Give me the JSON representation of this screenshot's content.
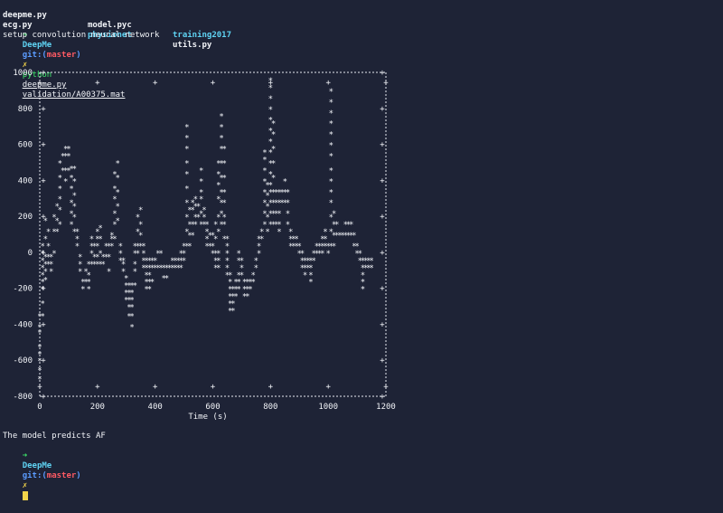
{
  "files": {
    "row1": [
      "deepme.py",
      "model.pyc",
      "training2017"
    ],
    "row2": [
      "ecg.py",
      "physionet",
      "utils.py"
    ]
  },
  "prompt": {
    "arrow": "➜",
    "dir": "DeepMe",
    "git_prefix": "git:(",
    "branch": "master",
    "git_suffix": ")",
    "dirty": "✗"
  },
  "command": {
    "program": "python",
    "script": "deepme.py",
    "arg": "validation/A00375.mat"
  },
  "output_line": "setup convolution neural network",
  "result_line": "The model predicts AF",
  "chart_data": {
    "type": "scatter",
    "xlabel": "Time (s)",
    "ylabel": "",
    "xlim": [
      0,
      1200
    ],
    "ylim": [
      -800,
      1000
    ],
    "xticks": [
      0,
      200,
      400,
      600,
      800,
      1000,
      1200
    ],
    "yticks": [
      1000,
      800,
      600,
      400,
      200,
      0,
      -200,
      -400,
      -600,
      -800
    ],
    "marker": "*",
    "grid": false,
    "style": "ascii",
    "points": [
      [
        0,
        -350
      ],
      [
        0,
        -410
      ],
      [
        0,
        -440
      ],
      [
        0,
        -520
      ],
      [
        0,
        -560
      ],
      [
        0,
        -600
      ],
      [
        0,
        -650
      ],
      [
        0,
        -700
      ],
      [
        10,
        -350
      ],
      [
        10,
        -280
      ],
      [
        10,
        -200
      ],
      [
        10,
        -160
      ],
      [
        10,
        -120
      ],
      [
        10,
        -80
      ],
      [
        10,
        -40
      ],
      [
        10,
        0
      ],
      [
        10,
        40
      ],
      [
        20,
        -150
      ],
      [
        20,
        -100
      ],
      [
        20,
        -60
      ],
      [
        20,
        -20
      ],
      [
        20,
        80
      ],
      [
        20,
        180
      ],
      [
        30,
        -60
      ],
      [
        30,
        -20
      ],
      [
        30,
        40
      ],
      [
        30,
        120
      ],
      [
        40,
        -100
      ],
      [
        40,
        -60
      ],
      [
        40,
        -20
      ],
      [
        50,
        0
      ],
      [
        50,
        120
      ],
      [
        50,
        200
      ],
      [
        60,
        120
      ],
      [
        60,
        180
      ],
      [
        60,
        260
      ],
      [
        70,
        160
      ],
      [
        70,
        240
      ],
      [
        70,
        300
      ],
      [
        70,
        360
      ],
      [
        70,
        420
      ],
      [
        70,
        500
      ],
      [
        80,
        460
      ],
      [
        80,
        540
      ],
      [
        90,
        580
      ],
      [
        90,
        540
      ],
      [
        90,
        460
      ],
      [
        90,
        400
      ],
      [
        100,
        580
      ],
      [
        100,
        540
      ],
      [
        100,
        460
      ],
      [
        110,
        470
      ],
      [
        110,
        420
      ],
      [
        110,
        360
      ],
      [
        110,
        280
      ],
      [
        110,
        220
      ],
      [
        110,
        160
      ],
      [
        120,
        470
      ],
      [
        120,
        400
      ],
      [
        120,
        320
      ],
      [
        120,
        260
      ],
      [
        120,
        200
      ],
      [
        120,
        120
      ],
      [
        130,
        120
      ],
      [
        130,
        80
      ],
      [
        130,
        40
      ],
      [
        140,
        -20
      ],
      [
        140,
        -60
      ],
      [
        140,
        -100
      ],
      [
        150,
        -160
      ],
      [
        150,
        -200
      ],
      [
        160,
        -160
      ],
      [
        160,
        -100
      ],
      [
        170,
        -160
      ],
      [
        170,
        -200
      ],
      [
        170,
        -120
      ],
      [
        170,
        -60
      ],
      [
        180,
        -60
      ],
      [
        180,
        0
      ],
      [
        180,
        40
      ],
      [
        180,
        80
      ],
      [
        190,
        -60
      ],
      [
        190,
        -20
      ],
      [
        190,
        40
      ],
      [
        200,
        -60
      ],
      [
        200,
        -20
      ],
      [
        200,
        40
      ],
      [
        200,
        80
      ],
      [
        200,
        120
      ],
      [
        210,
        -60
      ],
      [
        210,
        0
      ],
      [
        210,
        80
      ],
      [
        210,
        140
      ],
      [
        220,
        -60
      ],
      [
        220,
        -20
      ],
      [
        230,
        -20
      ],
      [
        230,
        40
      ],
      [
        240,
        -100
      ],
      [
        240,
        -20
      ],
      [
        240,
        40
      ],
      [
        250,
        40
      ],
      [
        250,
        80
      ],
      [
        250,
        100
      ],
      [
        260,
        80
      ],
      [
        260,
        160
      ],
      [
        260,
        220
      ],
      [
        260,
        300
      ],
      [
        260,
        360
      ],
      [
        260,
        440
      ],
      [
        270,
        500
      ],
      [
        270,
        420
      ],
      [
        270,
        340
      ],
      [
        270,
        260
      ],
      [
        270,
        180
      ],
      [
        280,
        40
      ],
      [
        280,
        0
      ],
      [
        280,
        -40
      ],
      [
        290,
        -40
      ],
      [
        290,
        -60
      ],
      [
        290,
        -100
      ],
      [
        300,
        -140
      ],
      [
        300,
        -180
      ],
      [
        300,
        -220
      ],
      [
        300,
        -260
      ],
      [
        310,
        -180
      ],
      [
        310,
        -220
      ],
      [
        310,
        -260
      ],
      [
        310,
        -300
      ],
      [
        310,
        -350
      ],
      [
        320,
        -180
      ],
      [
        320,
        -220
      ],
      [
        320,
        -260
      ],
      [
        320,
        -300
      ],
      [
        320,
        -350
      ],
      [
        320,
        -410
      ],
      [
        330,
        -180
      ],
      [
        330,
        -100
      ],
      [
        330,
        -60
      ],
      [
        330,
        0
      ],
      [
        330,
        40
      ],
      [
        340,
        0
      ],
      [
        340,
        40
      ],
      [
        340,
        120
      ],
      [
        340,
        200
      ],
      [
        350,
        40
      ],
      [
        350,
        100
      ],
      [
        350,
        160
      ],
      [
        350,
        240
      ],
      [
        360,
        40
      ],
      [
        360,
        0
      ],
      [
        360,
        -40
      ],
      [
        360,
        -80
      ],
      [
        370,
        -40
      ],
      [
        370,
        -80
      ],
      [
        370,
        -120
      ],
      [
        370,
        -160
      ],
      [
        370,
        -200
      ],
      [
        380,
        -40
      ],
      [
        380,
        -80
      ],
      [
        380,
        -120
      ],
      [
        380,
        -160
      ],
      [
        380,
        -200
      ],
      [
        390,
        -40
      ],
      [
        390,
        -80
      ],
      [
        390,
        -160
      ],
      [
        400,
        -40
      ],
      [
        400,
        -80
      ],
      [
        410,
        -80
      ],
      [
        410,
        0
      ],
      [
        420,
        -80
      ],
      [
        420,
        0
      ],
      [
        430,
        -80
      ],
      [
        430,
        -140
      ],
      [
        440,
        -80
      ],
      [
        440,
        -140
      ],
      [
        450,
        -80
      ],
      [
        460,
        -80
      ],
      [
        460,
        -40
      ],
      [
        470,
        -80
      ],
      [
        470,
        -40
      ],
      [
        480,
        -80
      ],
      [
        480,
        -40
      ],
      [
        490,
        -80
      ],
      [
        490,
        -40
      ],
      [
        490,
        0
      ],
      [
        500,
        -40
      ],
      [
        500,
        0
      ],
      [
        500,
        40
      ],
      [
        510,
        40
      ],
      [
        510,
        120
      ],
      [
        510,
        200
      ],
      [
        510,
        280
      ],
      [
        510,
        360
      ],
      [
        510,
        440
      ],
      [
        510,
        500
      ],
      [
        510,
        580
      ],
      [
        510,
        640
      ],
      [
        510,
        700
      ],
      [
        520,
        40
      ],
      [
        520,
        100
      ],
      [
        520,
        160
      ],
      [
        520,
        240
      ],
      [
        530,
        100
      ],
      [
        530,
        160
      ],
      [
        530,
        240
      ],
      [
        530,
        280
      ],
      [
        540,
        160
      ],
      [
        540,
        200
      ],
      [
        540,
        260
      ],
      [
        540,
        300
      ],
      [
        550,
        200
      ],
      [
        550,
        260
      ],
      [
        560,
        160
      ],
      [
        560,
        220
      ],
      [
        560,
        300
      ],
      [
        560,
        340
      ],
      [
        560,
        400
      ],
      [
        560,
        460
      ],
      [
        570,
        160
      ],
      [
        570,
        200
      ],
      [
        570,
        240
      ],
      [
        580,
        40
      ],
      [
        580,
        80
      ],
      [
        580,
        120
      ],
      [
        580,
        160
      ],
      [
        590,
        40
      ],
      [
        590,
        100
      ],
      [
        600,
        0
      ],
      [
        600,
        40
      ],
      [
        600,
        100
      ],
      [
        610,
        -40
      ],
      [
        610,
        -80
      ],
      [
        610,
        0
      ],
      [
        610,
        80
      ],
      [
        610,
        160
      ],
      [
        620,
        -80
      ],
      [
        620,
        -40
      ],
      [
        620,
        0
      ],
      [
        620,
        120
      ],
      [
        620,
        200
      ],
      [
        620,
        300
      ],
      [
        620,
        380
      ],
      [
        620,
        440
      ],
      [
        620,
        500
      ],
      [
        630,
        160
      ],
      [
        630,
        220
      ],
      [
        630,
        280
      ],
      [
        630,
        340
      ],
      [
        630,
        420
      ],
      [
        630,
        500
      ],
      [
        630,
        580
      ],
      [
        630,
        640
      ],
      [
        630,
        700
      ],
      [
        630,
        760
      ],
      [
        640,
        80
      ],
      [
        640,
        160
      ],
      [
        640,
        200
      ],
      [
        640,
        280
      ],
      [
        640,
        340
      ],
      [
        640,
        420
      ],
      [
        640,
        500
      ],
      [
        640,
        580
      ],
      [
        650,
        -40
      ],
      [
        650,
        -80
      ],
      [
        650,
        -120
      ],
      [
        650,
        0
      ],
      [
        650,
        40
      ],
      [
        650,
        80
      ],
      [
        660,
        -120
      ],
      [
        660,
        -160
      ],
      [
        660,
        -200
      ],
      [
        660,
        -240
      ],
      [
        660,
        -280
      ],
      [
        660,
        -320
      ],
      [
        670,
        -200
      ],
      [
        670,
        -240
      ],
      [
        670,
        -280
      ],
      [
        670,
        -320
      ],
      [
        680,
        -160
      ],
      [
        680,
        -200
      ],
      [
        680,
        -240
      ],
      [
        690,
        -120
      ],
      [
        690,
        -160
      ],
      [
        690,
        -200
      ],
      [
        690,
        -40
      ],
      [
        690,
        0
      ],
      [
        700,
        -40
      ],
      [
        700,
        -80
      ],
      [
        700,
        -120
      ],
      [
        710,
        -160
      ],
      [
        710,
        -200
      ],
      [
        710,
        -240
      ],
      [
        720,
        -160
      ],
      [
        720,
        -200
      ],
      [
        720,
        -240
      ],
      [
        730,
        -160
      ],
      [
        730,
        -200
      ],
      [
        740,
        -120
      ],
      [
        740,
        -160
      ],
      [
        750,
        -40
      ],
      [
        750,
        -80
      ],
      [
        760,
        0
      ],
      [
        760,
        40
      ],
      [
        760,
        80
      ],
      [
        770,
        80
      ],
      [
        770,
        120
      ],
      [
        780,
        160
      ],
      [
        780,
        220
      ],
      [
        780,
        280
      ],
      [
        780,
        340
      ],
      [
        780,
        400
      ],
      [
        780,
        460
      ],
      [
        780,
        520
      ],
      [
        780,
        560
      ],
      [
        790,
        120
      ],
      [
        790,
        200
      ],
      [
        790,
        260
      ],
      [
        790,
        320
      ],
      [
        790,
        380
      ],
      [
        800,
        160
      ],
      [
        800,
        220
      ],
      [
        800,
        280
      ],
      [
        800,
        340
      ],
      [
        800,
        380
      ],
      [
        800,
        440
      ],
      [
        800,
        500
      ],
      [
        800,
        560
      ],
      [
        800,
        620
      ],
      [
        800,
        680
      ],
      [
        800,
        740
      ],
      [
        800,
        800
      ],
      [
        800,
        860
      ],
      [
        800,
        920
      ],
      [
        800,
        960
      ],
      [
        810,
        160
      ],
      [
        810,
        220
      ],
      [
        810,
        280
      ],
      [
        810,
        340
      ],
      [
        810,
        420
      ],
      [
        810,
        500
      ],
      [
        810,
        580
      ],
      [
        810,
        660
      ],
      [
        810,
        720
      ],
      [
        820,
        160
      ],
      [
        820,
        220
      ],
      [
        820,
        280
      ],
      [
        820,
        340
      ],
      [
        830,
        120
      ],
      [
        830,
        160
      ],
      [
        830,
        220
      ],
      [
        830,
        280
      ],
      [
        830,
        340
      ],
      [
        840,
        280
      ],
      [
        840,
        340
      ],
      [
        850,
        280
      ],
      [
        850,
        340
      ],
      [
        850,
        400
      ],
      [
        860,
        160
      ],
      [
        860,
        220
      ],
      [
        860,
        280
      ],
      [
        860,
        340
      ],
      [
        870,
        120
      ],
      [
        870,
        80
      ],
      [
        870,
        40
      ],
      [
        880,
        40
      ],
      [
        880,
        80
      ],
      [
        890,
        40
      ],
      [
        890,
        80
      ],
      [
        900,
        0
      ],
      [
        900,
        40
      ],
      [
        910,
        0
      ],
      [
        910,
        -40
      ],
      [
        910,
        -80
      ],
      [
        920,
        -40
      ],
      [
        920,
        -80
      ],
      [
        920,
        -120
      ],
      [
        930,
        -40
      ],
      [
        930,
        -80
      ],
      [
        940,
        -40
      ],
      [
        940,
        -80
      ],
      [
        940,
        -120
      ],
      [
        940,
        -160
      ],
      [
        950,
        -40
      ],
      [
        950,
        0
      ],
      [
        960,
        0
      ],
      [
        960,
        40
      ],
      [
        970,
        0
      ],
      [
        970,
        40
      ],
      [
        980,
        0
      ],
      [
        980,
        40
      ],
      [
        980,
        80
      ],
      [
        990,
        40
      ],
      [
        990,
        80
      ],
      [
        990,
        120
      ],
      [
        1000,
        0
      ],
      [
        1000,
        40
      ],
      [
        1010,
        40
      ],
      [
        1010,
        120
      ],
      [
        1010,
        200
      ],
      [
        1010,
        280
      ],
      [
        1010,
        340
      ],
      [
        1010,
        400
      ],
      [
        1010,
        460
      ],
      [
        1010,
        540
      ],
      [
        1010,
        600
      ],
      [
        1010,
        660
      ],
      [
        1010,
        720
      ],
      [
        1010,
        780
      ],
      [
        1010,
        840
      ],
      [
        1010,
        900
      ],
      [
        1020,
        40
      ],
      [
        1020,
        100
      ],
      [
        1020,
        160
      ],
      [
        1020,
        220
      ],
      [
        1030,
        100
      ],
      [
        1030,
        160
      ],
      [
        1040,
        100
      ],
      [
        1050,
        100
      ],
      [
        1060,
        100
      ],
      [
        1060,
        160
      ],
      [
        1070,
        100
      ],
      [
        1070,
        160
      ],
      [
        1080,
        100
      ],
      [
        1080,
        160
      ],
      [
        1090,
        100
      ],
      [
        1090,
        40
      ],
      [
        1100,
        40
      ],
      [
        1100,
        0
      ],
      [
        1110,
        0
      ],
      [
        1110,
        -40
      ],
      [
        1120,
        -40
      ],
      [
        1120,
        -80
      ],
      [
        1120,
        -120
      ],
      [
        1120,
        -160
      ],
      [
        1120,
        -200
      ],
      [
        1130,
        -40
      ],
      [
        1130,
        -80
      ],
      [
        1140,
        -40
      ],
      [
        1140,
        -80
      ],
      [
        1150,
        -40
      ],
      [
        1150,
        -80
      ]
    ]
  }
}
